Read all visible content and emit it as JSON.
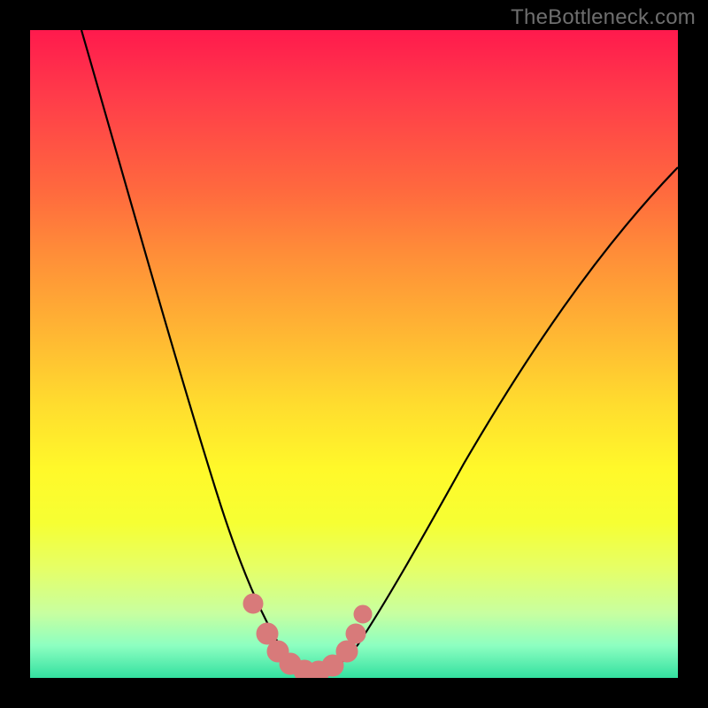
{
  "watermark": "TheBottleneck.com",
  "chart_data": {
    "type": "line",
    "title": "",
    "xlabel": "",
    "ylabel": "",
    "xlim": [
      0,
      100
    ],
    "ylim": [
      0,
      100
    ],
    "series": [
      {
        "name": "bottleneck-curve",
        "x": [
          8,
          12,
          16,
          20,
          24,
          28,
          31,
          33,
          35,
          37,
          39,
          41,
          43,
          45,
          47,
          50,
          55,
          60,
          65,
          70,
          75,
          80,
          85,
          90,
          95,
          100
        ],
        "y": [
          100,
          88,
          76,
          64,
          52,
          40,
          30,
          22,
          15,
          9,
          5,
          2,
          1,
          1,
          2,
          5,
          12,
          20,
          28,
          36,
          44,
          51,
          58,
          64,
          70,
          75
        ]
      }
    ],
    "markers": {
      "name": "highlighted-points",
      "color": "#d87a7a",
      "x": [
        33,
        36,
        38,
        40,
        42,
        44,
        46,
        48,
        49,
        50
      ],
      "y": [
        18,
        7,
        3,
        1,
        1,
        1,
        2,
        5,
        9,
        14
      ]
    },
    "background_gradient": {
      "top": "#ff1a4d",
      "mid": "#fff92a",
      "bottom": "#33e0a0"
    }
  }
}
